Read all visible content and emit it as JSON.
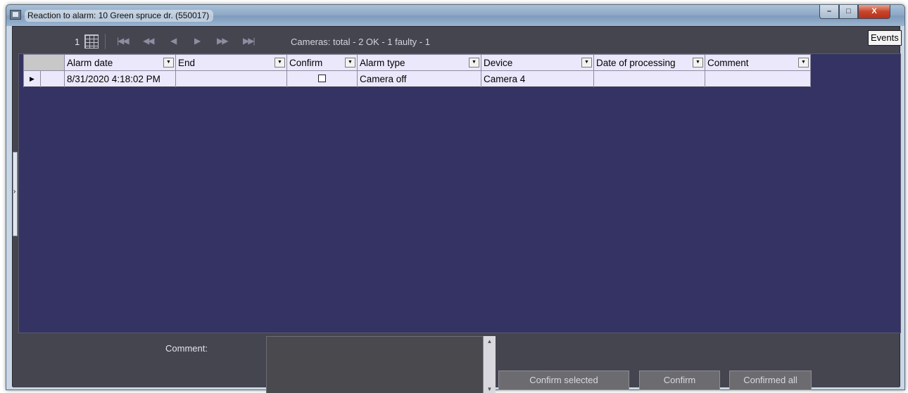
{
  "window": {
    "title": "Reaction to alarm: 10 Green spruce dr. (550017)",
    "minimize_glyph": "–",
    "maximize_glyph": "□",
    "close_glyph": "X"
  },
  "toolbar": {
    "page": "1",
    "status": "Cameras: total - 2  OK - 1  faulty - 1",
    "events_label": "Events",
    "nav_first": "|◀◀",
    "nav_prev_page": "◀◀",
    "nav_prev": "◀",
    "nav_next": "▶",
    "nav_next_page": "▶▶",
    "nav_last": "▶▶|"
  },
  "side_handle": {
    "glyph": "›"
  },
  "grid": {
    "columns": [
      "Alarm date",
      "End",
      "Confirm",
      "Alarm type",
      "Device",
      "Date of processing",
      "Comment"
    ],
    "rows": [
      {
        "indicator": "▶",
        "alarm_date": "8/31/2020 4:18:02 PM",
        "end": "",
        "confirm": false,
        "alarm_type": "Camera off",
        "device": "Camera 4",
        "date_of_processing": "",
        "comment": ""
      }
    ]
  },
  "bottom": {
    "comment_label": "Comment:",
    "comment_value": "",
    "confirm_selected_label": "Confirm selected",
    "confirm_label": "Confirm",
    "confirmed_all_label": "Confirmed all"
  },
  "colors": {
    "grid_background": "#343363",
    "panel_background": "#454550",
    "row_background": "#ebe8fb"
  }
}
